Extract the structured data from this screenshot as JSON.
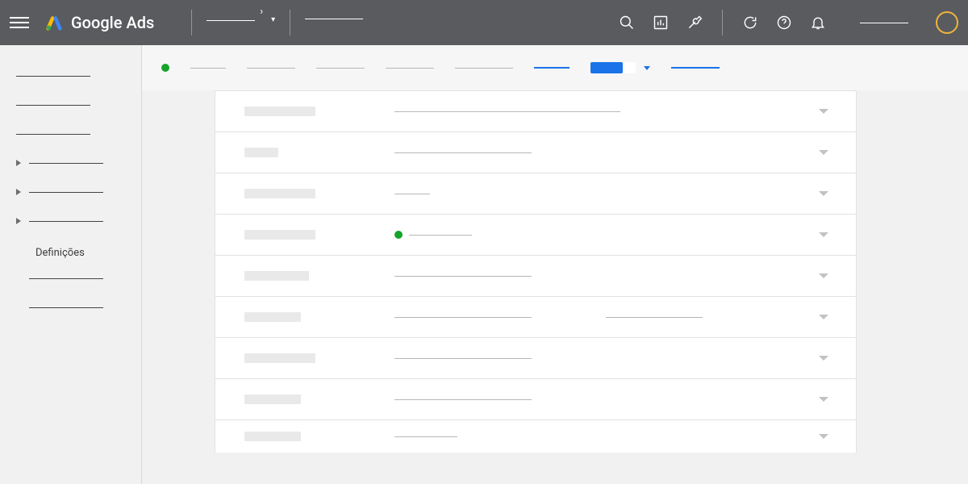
{
  "header": {
    "product_name": "Google Ads",
    "icons": {
      "menu": "hamburger-icon",
      "search": "search-icon",
      "reports": "bar-chart-icon",
      "tools": "wrench-icon",
      "refresh": "refresh-icon",
      "help": "help-icon",
      "notifications": "bell-icon"
    }
  },
  "sidebar": {
    "active_label": "Definições",
    "items": [
      {
        "has_arrow": false,
        "indent": false
      },
      {
        "has_arrow": false,
        "indent": false
      },
      {
        "has_arrow": false,
        "indent": false
      },
      {
        "has_arrow": true,
        "indent": false
      },
      {
        "has_arrow": true,
        "indent": false
      },
      {
        "has_arrow": true,
        "indent": false
      },
      {
        "has_arrow": false,
        "indent": true,
        "label": "Definições"
      },
      {
        "has_arrow": false,
        "indent": true
      },
      {
        "has_arrow": false,
        "indent": true
      }
    ]
  },
  "tabs": {
    "status": "enabled"
  },
  "settings_rows": [
    {
      "label_w": "w90",
      "val_class": "long",
      "has_dot": false
    },
    {
      "label_w": "w45",
      "val_class": "med",
      "has_dot": false
    },
    {
      "label_w": "w90",
      "val_class": "short",
      "has_dot": false
    },
    {
      "label_w": "w90",
      "val_class": "xshort",
      "has_dot": true
    },
    {
      "label_w": "w80",
      "val_class": "med",
      "has_dot": false
    },
    {
      "label_w": "w70",
      "val_class": "med",
      "has_dot": false,
      "has_right": true
    },
    {
      "label_w": "w90",
      "val_class": "med",
      "has_dot": false
    },
    {
      "label_w": "w70",
      "val_class": "med",
      "has_dot": false
    },
    {
      "label_w": "w70",
      "val_class": "xshort",
      "has_dot": false,
      "last": true
    }
  ],
  "colors": {
    "brand_green": "#17a32a",
    "brand_blue": "#1a73e8",
    "avatar_ring": "#f0b43a"
  }
}
